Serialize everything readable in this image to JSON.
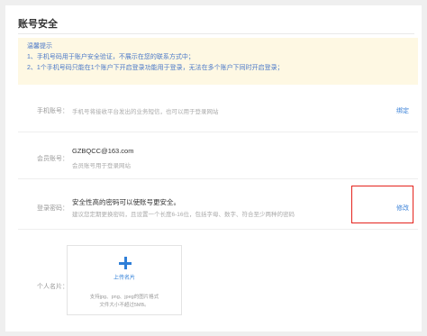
{
  "page": {
    "title": "账号安全"
  },
  "notice": {
    "heading": "温馨提示",
    "lines": [
      "1、手机号码用于账户安全验证，不展示在您的联系方式中；",
      "2、1个手机号码只能在1个账户下开启登录功能用于登录，无法在多个账户下同时开启登录；"
    ]
  },
  "phone": {
    "label": "手机账号：",
    "hint": "手机号将接收平台发出的业务短信，也可以用于登录网站",
    "action": "绑定"
  },
  "member": {
    "label": "会员账号：",
    "value": "GZBQCC@163.com",
    "hint": "会员账号用于登录网站"
  },
  "password": {
    "label": "登录密码：",
    "value": "安全性高的密码可以使账号更安全。",
    "hint": "建议您定期更换密码，且设置一个长度6-16位，包括字母、数字、符合至少两种的密码",
    "action": "修改"
  },
  "avatar": {
    "label": "个人名片：",
    "upload_label": "上传名片",
    "note_line1": "支持jpg、png、jpeg的图片格式",
    "note_line2": "文件大小不超过5MB。"
  },
  "colors": {
    "accent": "#3b82d8",
    "notice_bg": "#fef8e3",
    "highlight": "#e5231d"
  }
}
